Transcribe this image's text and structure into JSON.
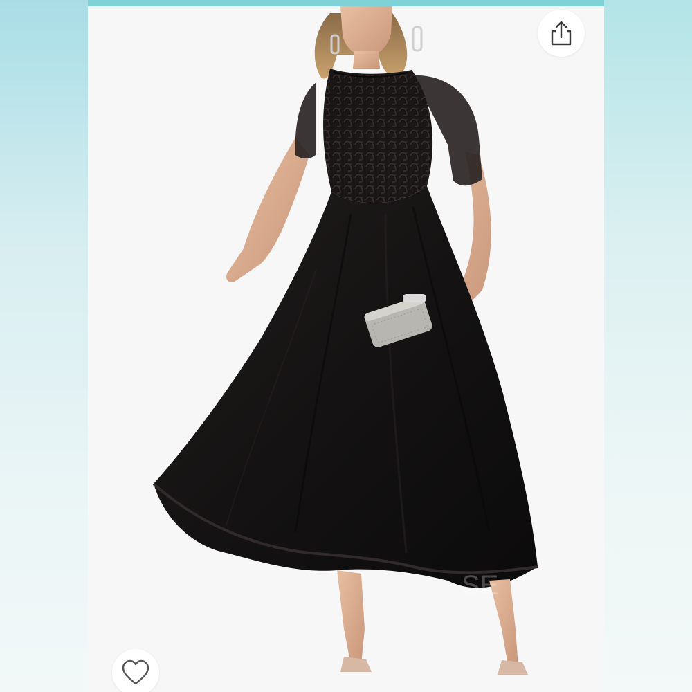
{
  "app": {
    "background_accent": "#7fd3d7"
  },
  "product_image": {
    "subject": "black-lace-high-low-dress",
    "dress_color": "#141212",
    "background_color": "#f7f7f7",
    "watermark_text": "SE"
  },
  "actions": {
    "share_icon": "share-icon",
    "like_icon": "heart-outline-icon"
  }
}
